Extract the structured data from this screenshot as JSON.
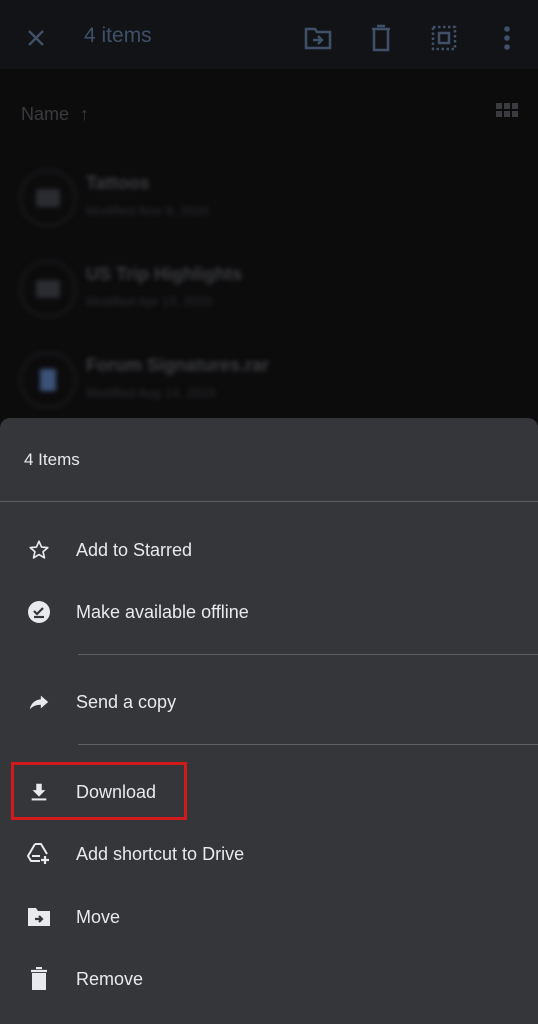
{
  "appbar": {
    "title": "4 items",
    "icons": [
      "close-icon",
      "move-to-folder-icon",
      "trash-icon",
      "select-all-icon",
      "more-vert-icon"
    ]
  },
  "sortbar": {
    "label": "Name",
    "direction_icon": "arrow-up-icon",
    "view_toggle_icon": "grid-view-icon"
  },
  "files": [
    {
      "name": "Tattoos",
      "meta": "Modified Nov 8, 2020",
      "type": "folder",
      "starred": true
    },
    {
      "name": "US Trip Highlights",
      "meta": "Modified Apr 13, 2020",
      "type": "folder",
      "starred": false
    },
    {
      "name": "Forum Signatures.rar",
      "meta": "Modified Aug 14, 2019",
      "type": "file",
      "starred": false
    }
  ],
  "sheet": {
    "title": "4 Items",
    "items": [
      {
        "label": "Add to Starred",
        "icon": "star-outline-icon"
      },
      {
        "label": "Make available offline",
        "icon": "offline-check-icon"
      },
      {
        "label": "Send a copy",
        "icon": "share-arrow-icon"
      },
      {
        "label": "Download",
        "icon": "download-icon",
        "highlighted": true
      },
      {
        "label": "Add shortcut to Drive",
        "icon": "drive-shortcut-icon"
      },
      {
        "label": "Move",
        "icon": "move-folder-icon"
      },
      {
        "label": "Remove",
        "icon": "trash-filled-icon"
      }
    ]
  },
  "colors": {
    "sheet_bg": "#35363a",
    "text": "#e8eaed",
    "highlight": "#d11a1a",
    "appbar_icon": "#3f5068"
  }
}
